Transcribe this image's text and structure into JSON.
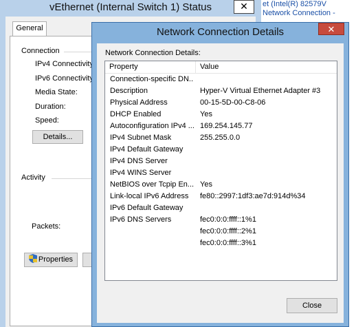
{
  "status_window": {
    "title": "vEthernet (Internal Switch 1) Status",
    "close_glyph": "✕",
    "tab": "General",
    "connection_label": "Connection",
    "fields": [
      "IPv4 Connectivity:",
      "IPv6 Connectivity:",
      "Media State:",
      "Duration:",
      "Speed:"
    ],
    "details_button": "Details...",
    "activity_label": "Activity",
    "packets_label": "Packets:",
    "properties_button": "Properties"
  },
  "right_window": {
    "line1": "et (Intel(R) 82579V",
    "line2": "Network Connection -"
  },
  "details_dialog": {
    "title": "Network Connection Details",
    "close_glyph": "✕",
    "caption": "Network Connection Details:",
    "columns": [
      "Property",
      "Value"
    ],
    "rows": [
      {
        "property": "Connection-specific DN...",
        "value": ""
      },
      {
        "property": "Description",
        "value": "Hyper-V Virtual Ethernet Adapter #3"
      },
      {
        "property": "Physical Address",
        "value": "00-15-5D-00-C8-06"
      },
      {
        "property": "DHCP Enabled",
        "value": "Yes"
      },
      {
        "property": "Autoconfiguration IPv4 ...",
        "value": "169.254.145.77"
      },
      {
        "property": "IPv4 Subnet Mask",
        "value": "255.255.0.0"
      },
      {
        "property": "IPv4 Default Gateway",
        "value": ""
      },
      {
        "property": "IPv4 DNS Server",
        "value": ""
      },
      {
        "property": "IPv4 WINS Server",
        "value": ""
      },
      {
        "property": "NetBIOS over Tcpip En...",
        "value": "Yes"
      },
      {
        "property": "Link-local IPv6 Address",
        "value": "fe80::2997:1df3:ae7d:914d%34"
      },
      {
        "property": "IPv6 Default Gateway",
        "value": ""
      },
      {
        "property": "IPv6 DNS Servers",
        "value": "fec0:0:0:ffff::1%1"
      },
      {
        "property": "",
        "value": "fec0:0:0:ffff::2%1"
      },
      {
        "property": "",
        "value": "fec0:0:0:ffff::3%1"
      }
    ],
    "close_button": "Close"
  },
  "colors": {
    "inactive_frame": "#b9d1ea",
    "active_frame": "#86b2dc",
    "close_red": "#c74b3d",
    "link_blue": "#1a4fa6"
  }
}
